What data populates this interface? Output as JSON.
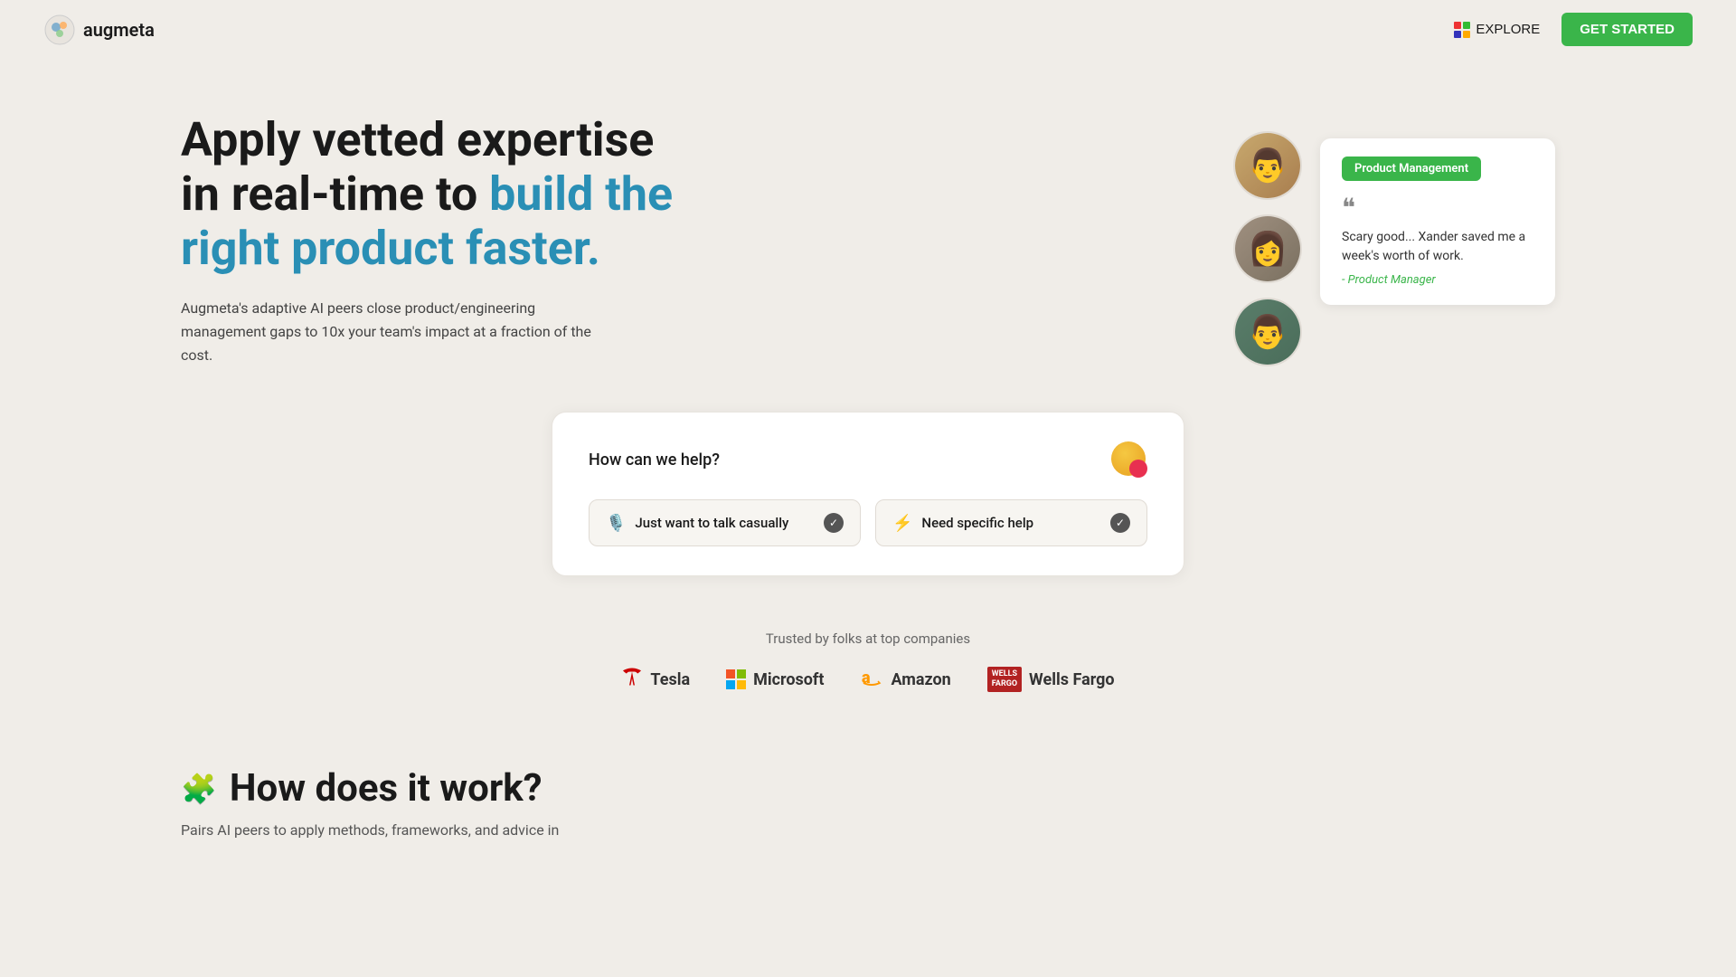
{
  "nav": {
    "logo_text": "augmeta",
    "explore_label": "EXPLORE",
    "get_started_label": "GET STARTED"
  },
  "hero": {
    "heading_part1": "Apply vetted expertise in real-time to ",
    "heading_accent": "build the right product faster.",
    "subtext": "Augmeta's adaptive AI peers close product/engineering management gaps to 10x your team's impact at a fraction of the cost.",
    "testimonial": {
      "badge": "Product Management",
      "quote": "Scary good... Xander saved me a week's worth of work.",
      "author": "- Product Manager"
    }
  },
  "help_card": {
    "question": "How can we help?",
    "option1_label": "Just want to talk casually",
    "option2_label": "Need specific help"
  },
  "trusted": {
    "title": "Trusted by folks at top companies",
    "companies": [
      "Tesla",
      "Microsoft",
      "Amazon",
      "Wells Fargo"
    ]
  },
  "how": {
    "title": "How does it work?",
    "subtitle": "Pairs AI peers to apply methods, frameworks, and advice in"
  }
}
